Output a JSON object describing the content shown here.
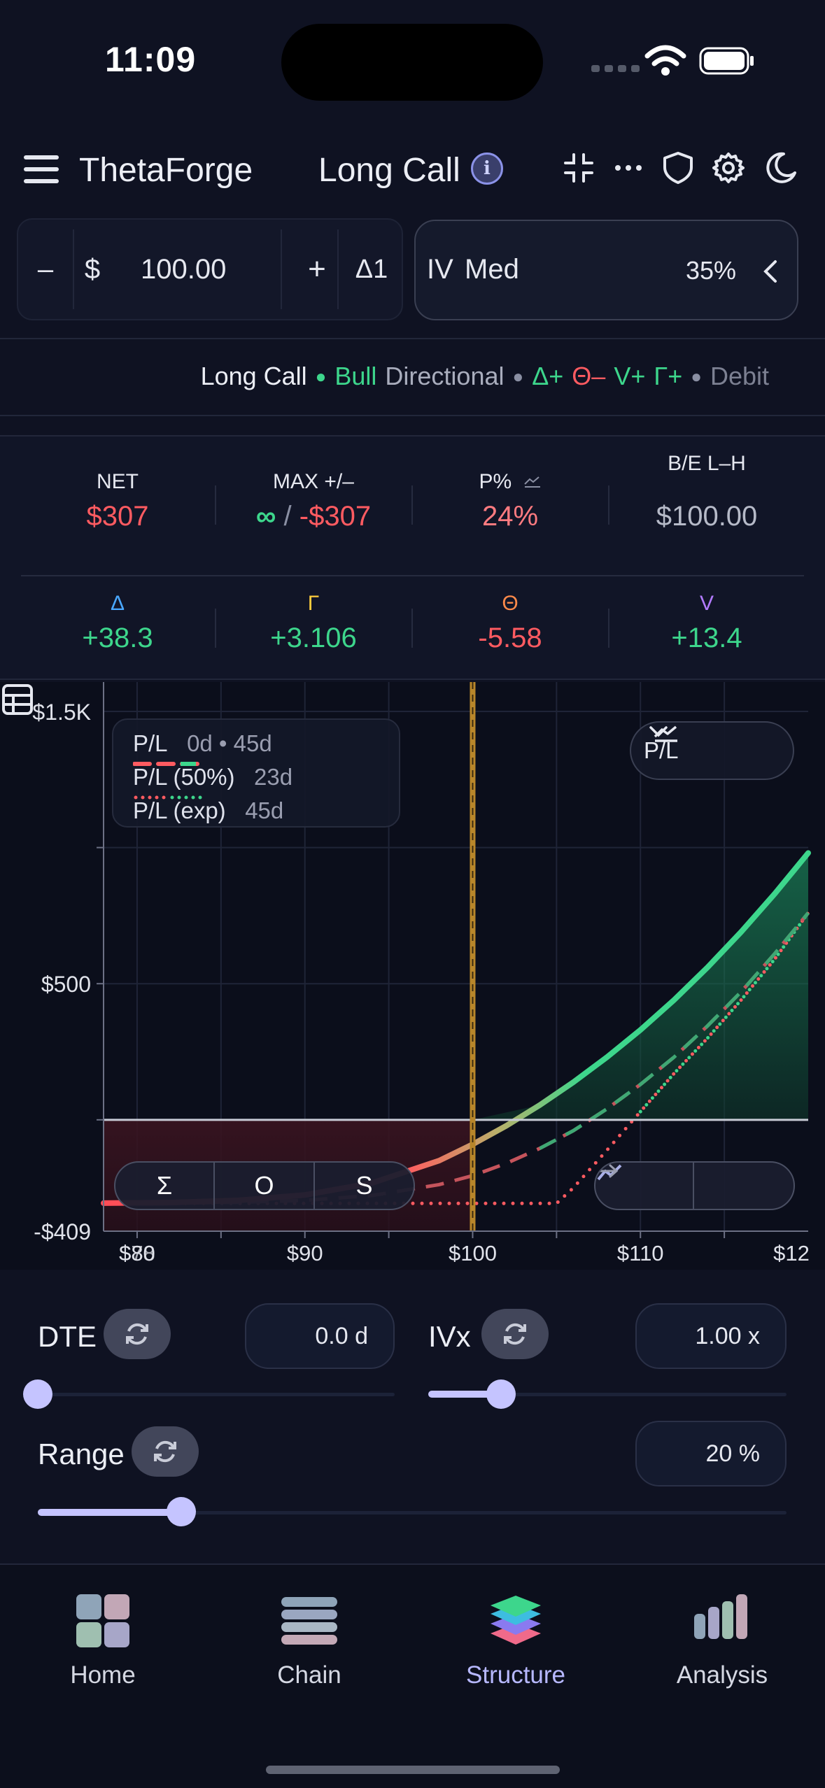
{
  "status": {
    "time": "11:09"
  },
  "header": {
    "app_name": "ThetaForge",
    "strategy_title": "Long Call",
    "info_glyph": "i"
  },
  "price_control": {
    "minus": "–",
    "currency": "$",
    "value": "100.00",
    "plus": "+",
    "delta_step": "Δ1"
  },
  "iv_control": {
    "label": "IV",
    "level": "Med",
    "value": "35%"
  },
  "tags": {
    "name": "Long Call",
    "bias": "Bull",
    "type": "Directional",
    "delta": "Δ+",
    "theta": "Θ–",
    "vega": "V+",
    "gamma": "Γ+",
    "cash": "Debit",
    "colors": {
      "green": "#3dd68c",
      "red": "#ff5b61",
      "gray": "#8a8fa3"
    }
  },
  "stats": {
    "net": {
      "label": "NET",
      "value": "$307"
    },
    "max": {
      "label": "MAX +/–",
      "max_gain": "∞",
      "sep": " / ",
      "max_loss": "-$307"
    },
    "pop": {
      "label": "P%",
      "value": "24%"
    },
    "breakeven": {
      "label": "B/E L–H",
      "value": "$100.00"
    }
  },
  "greeks": {
    "delta": {
      "label": "Δ",
      "value": "+38.3"
    },
    "gamma": {
      "label": "Γ",
      "value": "+3.106"
    },
    "theta": {
      "label": "Θ",
      "value": "-5.58"
    },
    "vega": {
      "label": "V",
      "value": "+13.4"
    }
  },
  "chart": {
    "legend": [
      {
        "name": "P/L",
        "detail": "0d • 45d"
      },
      {
        "name": "P/L (50%)",
        "detail": "23d"
      },
      {
        "name": "P/L (exp)",
        "detail": "45d"
      }
    ],
    "view_select": "P/L",
    "mode_buttons": [
      "Σ",
      "O",
      "S"
    ]
  },
  "chart_data": {
    "type": "line",
    "xlim": [
      78,
      120
    ],
    "ylim": [
      -409,
      1500
    ],
    "x_ticks": [
      "$80",
      "$90",
      "$100",
      "$110",
      "$12"
    ],
    "x_tick_overlap": "$78",
    "y_ticks": [
      "$1.5K",
      "$500",
      "-$409"
    ],
    "zero_line": 0,
    "current_price": 100,
    "series": [
      {
        "name": "P/L",
        "x": [
          78,
          82,
          86,
          90,
          94,
          98,
          100,
          102,
          104,
          106,
          108,
          110,
          112,
          114,
          116,
          118,
          120
        ],
        "y": [
          -306,
          -304,
          -296,
          -276,
          -232,
          -150,
          -90,
          -22,
          54,
          138,
          230,
          330,
          440,
          560,
          690,
          830,
          980
        ]
      },
      {
        "name": "P/L (50%)",
        "x": [
          78,
          82,
          86,
          90,
          94,
          98,
          100,
          102,
          104,
          106,
          108,
          110,
          112,
          114,
          116,
          118,
          120
        ],
        "y": [
          -307,
          -306,
          -303,
          -296,
          -278,
          -238,
          -205,
          -160,
          -105,
          -40,
          40,
          130,
          230,
          345,
          470,
          610,
          760
        ]
      },
      {
        "name": "P/L (exp)",
        "x": [
          78,
          80,
          90,
          100,
          104,
          105,
          106,
          108,
          110,
          112,
          114,
          116,
          118,
          120
        ],
        "y": [
          -307,
          -307,
          -307,
          -307,
          -307,
          -307,
          -250,
          -112,
          30,
          170,
          300,
          440,
          590,
          760
        ]
      }
    ]
  },
  "sliders": {
    "dte": {
      "label": "DTE",
      "value": "0.0",
      "unit": "d",
      "fraction": 0.0
    },
    "ivx": {
      "label": "IVx",
      "value": "1.00",
      "unit": "x",
      "fraction": 0.2
    },
    "range": {
      "label": "Range",
      "value": "20",
      "unit": "%",
      "fraction": 0.19
    }
  },
  "tabs": [
    {
      "label": "Home"
    },
    {
      "label": "Chain"
    },
    {
      "label": "Structure",
      "active": true
    },
    {
      "label": "Analysis"
    }
  ],
  "colors": {
    "active_tab": "#b7b8ff",
    "accent": "#c5c4ff"
  }
}
